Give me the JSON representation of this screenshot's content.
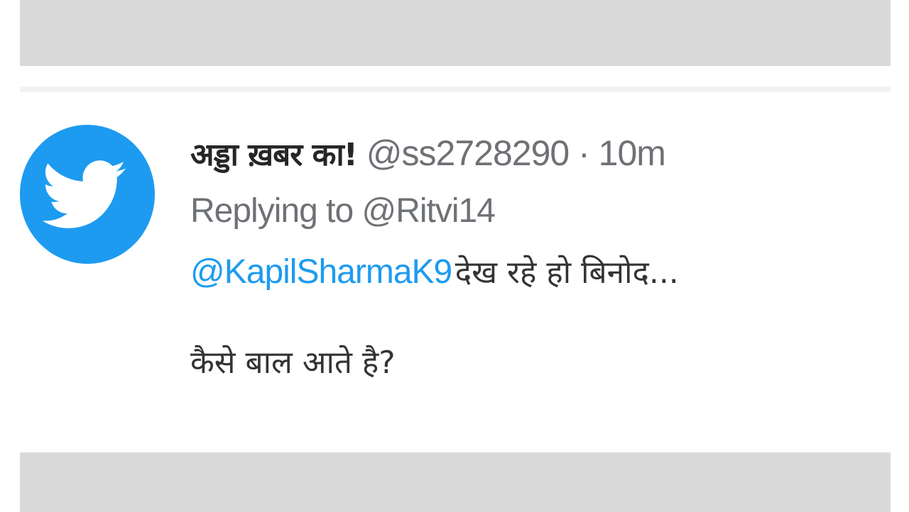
{
  "tweet": {
    "display_name": "अड्डा ख़बर का!",
    "handle": "@ss2728290",
    "separator": "·",
    "time": "10m",
    "replying_to_prefix": "Replying to",
    "replying_to_handle": "@Ritvi14",
    "mention": "@KapilSharmaK9",
    "text_line1": "देख रहे हो बिनोद...",
    "text_line2": "कैसे बाल आते है?",
    "avatar_icon": "twitter-bird-icon"
  },
  "colors": {
    "avatar_bg": "#1d9bf0",
    "mention": "#1d9bf0",
    "muted_text": "#6e7175",
    "band": "#d9d9d9"
  }
}
